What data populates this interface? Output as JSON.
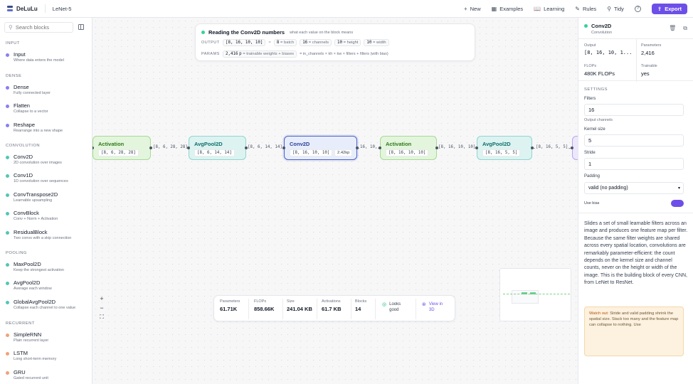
{
  "app": {
    "name": "DeLuLu",
    "model_name": "LeNet-5"
  },
  "topbar": {
    "actions": [
      {
        "label": "New",
        "icon": "plus-icon"
      },
      {
        "label": "Examples",
        "icon": "grid-icon"
      },
      {
        "label": "Learning",
        "icon": "book-icon"
      },
      {
        "label": "Rules",
        "icon": "pencil-icon"
      },
      {
        "label": "Tidy",
        "icon": "wand-icon"
      }
    ],
    "help_icon": "?",
    "export_label": "Export"
  },
  "sidebar": {
    "search_placeholder": "Search blocks",
    "categories": [
      {
        "name": "INPUT",
        "blocks": [
          {
            "name": "Input",
            "desc": "Where data enters the model",
            "color": "#8a7ff0"
          }
        ]
      },
      {
        "name": "DENSE",
        "blocks": [
          {
            "name": "Dense",
            "desc": "Fully connected layer",
            "color": "#8a7ff0"
          },
          {
            "name": "Flatten",
            "desc": "Collapse to a vector",
            "color": "#8a7ff0"
          },
          {
            "name": "Reshape",
            "desc": "Rearrange into a new shape",
            "color": "#8a7ff0"
          }
        ]
      },
      {
        "name": "CONVOLUTION",
        "blocks": [
          {
            "name": "Conv2D",
            "desc": "2D convolution over images",
            "color": "#53c6b8"
          },
          {
            "name": "Conv1D",
            "desc": "1D convolution over sequences",
            "color": "#53c6b8"
          },
          {
            "name": "ConvTranspose2D",
            "desc": "Learnable upsampling",
            "color": "#53c6b8"
          },
          {
            "name": "ConvBlock",
            "desc": "Conv + Norm + Activation",
            "color": "#53c6b8"
          },
          {
            "name": "ResidualBlock",
            "desc": "Two convs with a skip connection",
            "color": "#53c6b8"
          }
        ]
      },
      {
        "name": "POOLING",
        "blocks": [
          {
            "name": "MaxPool2D",
            "desc": "Keep the strongest activation",
            "color": "#53c6b8"
          },
          {
            "name": "AvgPool2D",
            "desc": "Average each window",
            "color": "#53c6b8"
          },
          {
            "name": "GlobalAvgPool2D",
            "desc": "Collapse each channel to one value",
            "color": "#53c6b8"
          }
        ]
      },
      {
        "name": "RECURRENT",
        "blocks": [
          {
            "name": "SimpleRNN",
            "desc": "Plain recurrent layer",
            "color": "#f0a27a"
          },
          {
            "name": "LSTM",
            "desc": "Long short-term memory",
            "color": "#f0a27a"
          },
          {
            "name": "GRU",
            "desc": "Gated recurrent unit",
            "color": "#f0a27a"
          }
        ]
      }
    ]
  },
  "explainer": {
    "title": "Reading the Conv2D numbers",
    "subtitle": "what each value on the block means",
    "output_label": "OUTPUT",
    "output_shape": "[8, 16, 10, 10]",
    "eq": "=",
    "output_parts": [
      {
        "value": "8",
        "meaning": "= batch"
      },
      {
        "value": "16",
        "meaning": "= channels"
      },
      {
        "value": "10",
        "meaning": "= height"
      },
      {
        "value": "10",
        "meaning": "= width"
      }
    ],
    "params_label": "PARAMS",
    "params_value": "2,416",
    "params_unit": "p",
    "params_meaning": "= trainable weights + biases",
    "params_formula": "= in_channels × kh × kw × filters + filters (with bias)"
  },
  "graph": {
    "nodes": [
      {
        "title": "Activation",
        "shape": "[8, 6, 28, 28]",
        "kind": "act"
      },
      {
        "title": "AvgPool2D",
        "shape": "[8, 6, 14, 14]",
        "kind": "pool"
      },
      {
        "title": "Conv2D",
        "shape": "[8, 16, 10, 10]",
        "params": "2.42kp",
        "kind": "conv"
      },
      {
        "title": "Activation",
        "shape": "[8, 16, 10, 10]",
        "kind": "act"
      },
      {
        "title": "AvgPool2D",
        "shape": "[8, 16, 5, 5]",
        "kind": "pool"
      }
    ],
    "edges": [
      "[8, 6, 28, 28]",
      "[8, 6, 14, 14]",
      "16, 10,",
      "[8, 16, 10, 10]",
      "[8, 16, 5, 5]"
    ]
  },
  "zoom_controls": {
    "zoom_in": "+",
    "zoom_out": "−",
    "fit": "⛶"
  },
  "stats": {
    "items": [
      {
        "label": "Parameters",
        "value": "61.71K"
      },
      {
        "label": "FLOPs",
        "value": "858.66K"
      },
      {
        "label": "Size",
        "value": "241.04 KB"
      },
      {
        "label": "Activations",
        "value": "61.7 KB"
      },
      {
        "label": "Blocks",
        "value": "14"
      }
    ],
    "status": "Looks good",
    "view3d": "View in 3D"
  },
  "inspector": {
    "title": "Conv2D",
    "subtitle": "Convolution",
    "output_label": "Output",
    "output_value": "[8, 16, 10, 1...",
    "params_label": "Parameters",
    "params_value": "2,416",
    "flops_label": "FLOPs",
    "flops_value": "480K FLOPs",
    "trainable_label": "Trainable",
    "trainable_value": "yes",
    "settings_title": "SETTINGS",
    "filters_label": "Filters",
    "filters_value": "16",
    "filters_hint": "Output channels",
    "kernel_label": "Kernel size",
    "kernel_value": "5",
    "stride_label": "Stride",
    "stride_value": "1",
    "padding_label": "Padding",
    "padding_value": "valid (no padding)",
    "bias_label": "Use bias",
    "bias_on": true,
    "description": "Slides a set of small learnable filters across an image and produces one feature map per filter. Because the same filter weights are shared across every spatial location, convolutions are remarkably parameter-efficient: the count depends on the kernel size and channel counts, never on the height or width of the image. This is the building block of every CNN, from LeNet to ResNet.",
    "warning_title": "Watch out:",
    "warning_text": "Stride and valid padding shrink the spatial size. Stack too many and the feature map can collapse to nothing. Use"
  }
}
